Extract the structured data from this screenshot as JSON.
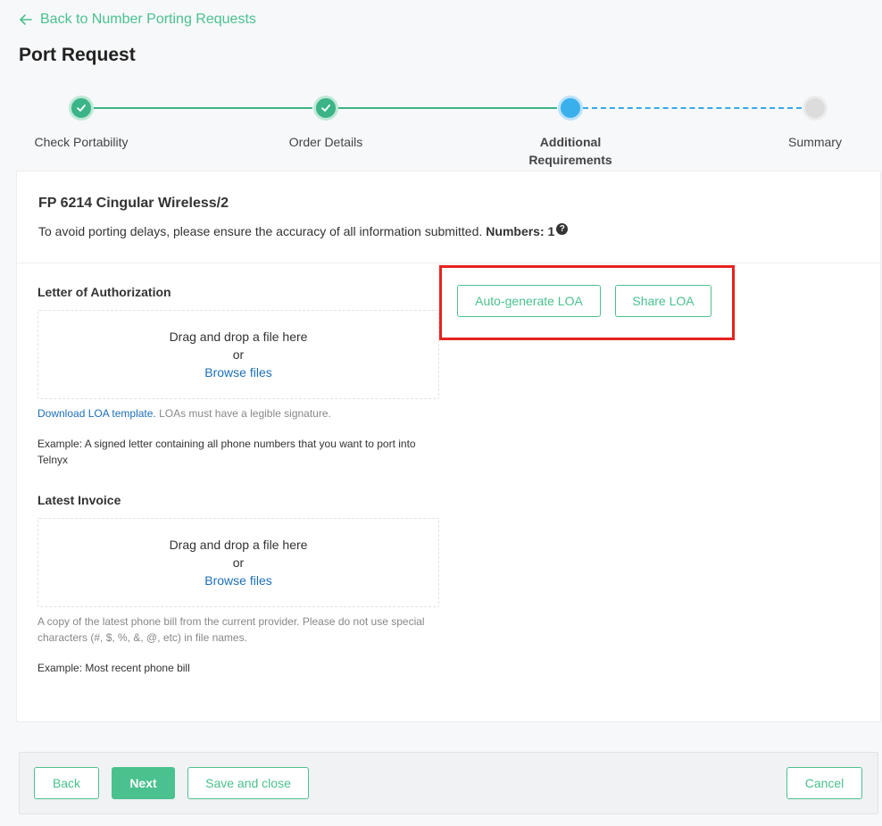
{
  "nav": {
    "back_label": "Back to Number Porting Requests"
  },
  "page": {
    "title": "Port Request"
  },
  "stepper": {
    "steps": [
      {
        "label": "Check Portability",
        "status": "done"
      },
      {
        "label": "Order Details",
        "status": "done"
      },
      {
        "label": "Additional Requirements",
        "status": "active"
      },
      {
        "label": "Summary",
        "status": "pending"
      }
    ]
  },
  "card": {
    "title": "FP 6214 Cingular Wireless/2",
    "subtitle": "To avoid porting delays, please ensure the accuracy of all information submitted.",
    "numbers_label": "Numbers: 1",
    "help_glyph": "?"
  },
  "loa": {
    "title": "Letter of Authorization",
    "drop_text": "Drag and drop a file here",
    "or_text": "or",
    "browse_label": "Browse files",
    "template_link": "Download LOA template.",
    "note": " LOAs must have a legible signature.",
    "example": "Example: A signed letter containing all phone numbers that you want to port into Telnyx",
    "autogen_label": "Auto-generate LOA",
    "share_label": "Share LOA"
  },
  "invoice": {
    "title": "Latest Invoice",
    "drop_text": "Drag and drop a file here",
    "or_text": "or",
    "browse_label": "Browse files",
    "note": "A copy of the latest phone bill from the current provider. Please do not use special characters (#, $, %, &, @, etc) in file names.",
    "example": "Example: Most recent phone bill"
  },
  "footer": {
    "back_label": "Back",
    "next_label": "Next",
    "save_label": "Save and close",
    "cancel_label": "Cancel"
  },
  "colors": {
    "accent": "#4ac18e",
    "step_done": "#3bb487",
    "step_active": "#39b0ec",
    "link": "#1d6fb8",
    "highlight": "#e8221f"
  },
  "icons": {
    "back": "arrow-left-icon",
    "step_done": "checkmark-icon",
    "help": "question-circle-icon"
  }
}
